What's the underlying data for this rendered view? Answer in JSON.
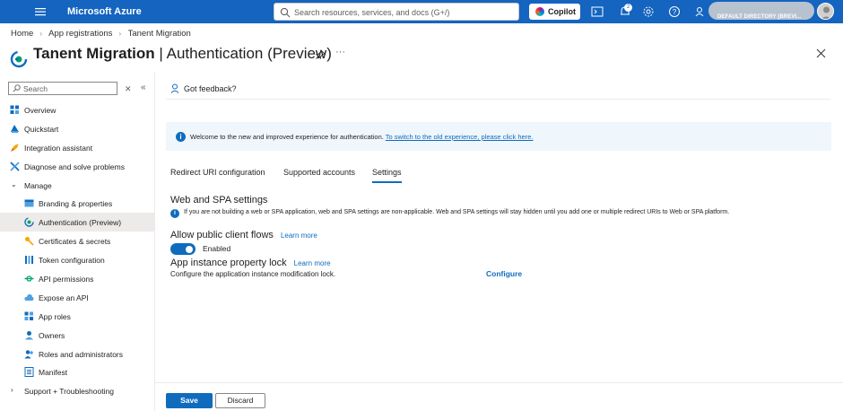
{
  "topbar": {
    "brand": "Microsoft Azure",
    "search_placeholder": "Search resources, services, and docs (G+/)",
    "copilot_label": "Copilot",
    "notification_count": "2",
    "directory": "DEFAULT DIRECTORY (BREVI..."
  },
  "breadcrumb": [
    "Home",
    "App registrations",
    "Tanent Migration"
  ],
  "page": {
    "title_app": "Tanent Migration",
    "title_section": " | Authentication (Preview)"
  },
  "sidebar": {
    "search_placeholder": "Search",
    "items": [
      {
        "label": "Overview",
        "icon": "overview-icon",
        "color": "#0f6cbd"
      },
      {
        "label": "Quickstart",
        "icon": "quickstart-icon",
        "color": "#0f6cbd"
      },
      {
        "label": "Integration assistant",
        "icon": "rocket-icon",
        "color": "#f7a800"
      },
      {
        "label": "Diagnose and solve problems",
        "icon": "wrench-icon",
        "color": "#0f6cbd"
      },
      {
        "label": "Manage",
        "icon": "chevron-down-icon",
        "color": "#323130"
      },
      {
        "label": "Branding & properties",
        "icon": "branding-icon",
        "color": "#0f6cbd"
      },
      {
        "label": "Authentication (Preview)",
        "icon": "authentication-icon",
        "color": "#0f6cbd"
      },
      {
        "label": "Certificates & secrets",
        "icon": "key-icon",
        "color": "#f7a800"
      },
      {
        "label": "Token configuration",
        "icon": "token-icon",
        "color": "#0f6cbd"
      },
      {
        "label": "API permissions",
        "icon": "api-permissions-icon",
        "color": "#00a36c"
      },
      {
        "label": "Expose an API",
        "icon": "cloud-icon",
        "color": "#0f6cbd"
      },
      {
        "label": "App roles",
        "icon": "app-roles-icon",
        "color": "#0f6cbd"
      },
      {
        "label": "Owners",
        "icon": "owners-icon",
        "color": "#0f6cbd"
      },
      {
        "label": "Roles and administrators",
        "icon": "roles-icon",
        "color": "#0f6cbd"
      },
      {
        "label": "Manifest",
        "icon": "manifest-icon",
        "color": "#0f6cbd"
      },
      {
        "label": "Support + Troubleshooting",
        "icon": "chevron-right-icon",
        "color": "#323130"
      }
    ]
  },
  "main": {
    "feedback": "Got feedback?",
    "banner_text": "Welcome to the new and improved experience for authentication.",
    "banner_link": "To switch to the old experience, please click here.",
    "tabs": [
      "Redirect URI configuration",
      "Supported accounts",
      "Settings"
    ],
    "active_tab": "Settings",
    "spa_heading": "Web and SPA settings",
    "spa_info": "If you are not building a web or SPA application, web and SPA settings are non-applicable. Web and SPA settings will stay hidden until you add one or multiple redirect URIs to Web or SPA platform.",
    "flows_heading": "Allow public client flows",
    "learn_more": "Learn more",
    "toggle_label": "Enabled",
    "toggle_on": true,
    "lock_heading": "App instance property lock",
    "lock_learn_more": "Learn more",
    "lock_desc": "Configure the application instance modification lock.",
    "configure_label": "Configure",
    "save_label": "Save",
    "discard_label": "Discard"
  },
  "colors": {
    "topbar": "#1464c0",
    "accent": "#0f6cbd",
    "banner": "#eff6fc"
  }
}
